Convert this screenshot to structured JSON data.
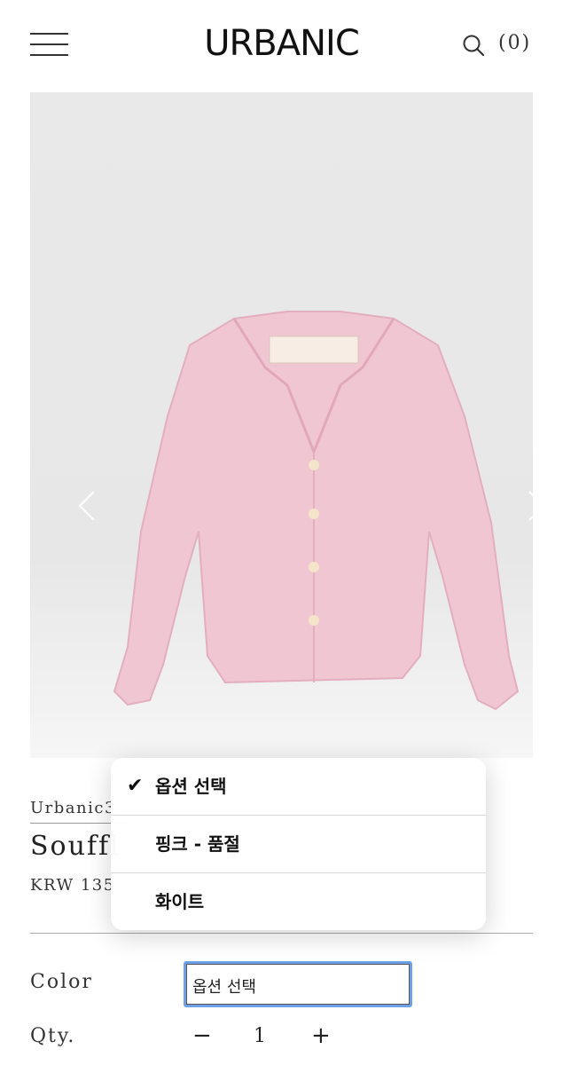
{
  "header": {
    "logo": "URBANIC",
    "cart_count": "(0)"
  },
  "gallery": {
    "image_alt": "pink long-sleeve camp collar shirt",
    "colors": {
      "shirt": "#f0c6d2",
      "background": "#e8e8e8"
    }
  },
  "product": {
    "brand": "Urbanic3",
    "title": "Souffl",
    "price": "KRW 135"
  },
  "form": {
    "color_label": "Color",
    "select_value": "옵션 선택",
    "qty_label": "Qty.",
    "qty_minus": "−",
    "qty_value": "1",
    "qty_plus": "+"
  },
  "dropdown": {
    "options": [
      {
        "label": "옵션 선택",
        "selected": true
      },
      {
        "label": "핑크 - 품절",
        "selected": false
      },
      {
        "label": "화이트",
        "selected": false
      }
    ],
    "check_mark": "✔"
  },
  "accent_color": "#6ea0e6"
}
